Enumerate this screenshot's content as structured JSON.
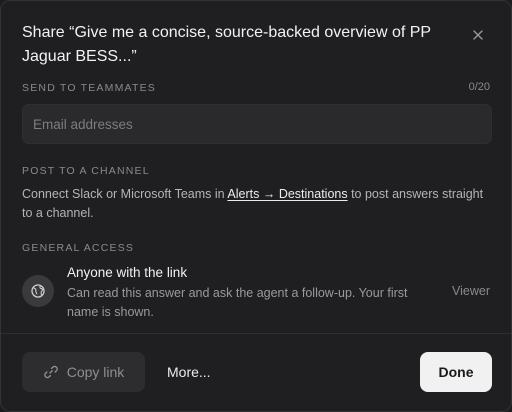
{
  "dialog": {
    "title": "Share “Give me a concise, source-backed overview of PP Jaguar BESS...”",
    "close_icon": "close-icon"
  },
  "teammates": {
    "label": "SEND TO TEAMMATES",
    "counter": "0/20",
    "placeholder": "Email addresses"
  },
  "channel": {
    "label": "POST TO A CHANNEL",
    "text_before": "Connect Slack or Microsoft Teams in ",
    "link": "Alerts → Destinations",
    "text_after": " to post answers straight to a channel."
  },
  "access": {
    "label": "GENERAL ACCESS",
    "icon": "globe-icon",
    "title": "Anyone with the link",
    "description": "Can read this answer and ask the agent a follow-up. Your first name is shown.",
    "role": "Viewer"
  },
  "footer": {
    "copy_label": "Copy link",
    "copy_icon": "link-icon",
    "more_label": "More...",
    "done_label": "Done"
  },
  "colors": {
    "background": "#1f1f21",
    "primary_button": "#f1f1f1",
    "muted_text": "#8a8a8e"
  }
}
